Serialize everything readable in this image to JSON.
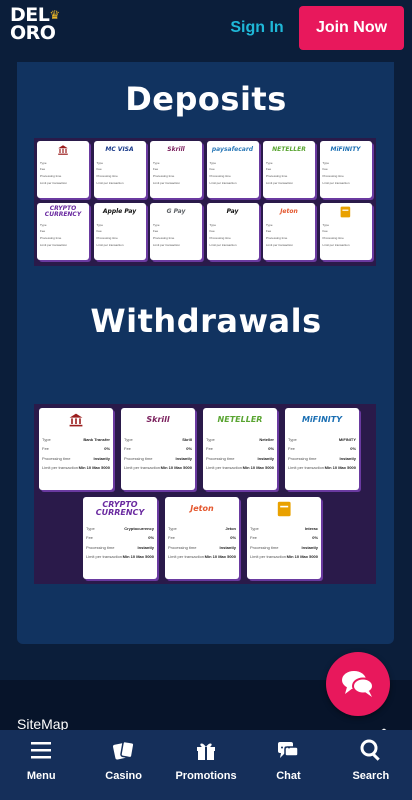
{
  "header": {
    "logo_line1": "DEL",
    "logo_line2": "ORO",
    "sign_in": "Sign In",
    "join_now": "Join Now"
  },
  "sections": {
    "deposits_title": "Deposits",
    "withdrawals_title": "Withdrawals"
  },
  "deposit_methods": [
    {
      "logo": "bank-icon",
      "color": "#9b1d1d"
    },
    {
      "logo": "MC VISA",
      "color": "#1a3a8a"
    },
    {
      "logo": "Skrill",
      "color": "#7a1f5c"
    },
    {
      "logo": "paysafecard",
      "color": "#2d7ab8"
    },
    {
      "logo": "NETELLER",
      "color": "#5aa532"
    },
    {
      "logo": "MiFINITY",
      "color": "#1b6fb3"
    },
    {
      "logo": "CRYPTO CURRENCY",
      "color": "#6a2aa0"
    },
    {
      "logo": "Apple Pay",
      "color": "#111111"
    },
    {
      "logo": "G Pay",
      "color": "#5f6368"
    },
    {
      "logo": "Pay",
      "color": "#111111"
    },
    {
      "logo": "Jeton",
      "color": "#e4572e"
    },
    {
      "logo": "wallet-icon",
      "color": "#e9a100"
    }
  ],
  "withdrawal_methods": [
    {
      "logo": "bank-icon",
      "color": "#9b1d1d",
      "type": "Bank Transfer",
      "fee": "0%",
      "time": "Instantly",
      "limit_min": "Min 10",
      "limit_max": "Max 5000"
    },
    {
      "logo": "Skrill",
      "color": "#7a1f5c",
      "type": "Skrill",
      "fee": "0%",
      "time": "Instantly",
      "limit_min": "Min 10",
      "limit_max": "Max 5000"
    },
    {
      "logo": "NETELLER",
      "color": "#5aa532",
      "type": "Neteller",
      "fee": "0%",
      "time": "Instantly",
      "limit_min": "Min 10",
      "limit_max": "Max 5000"
    },
    {
      "logo": "MiFINITY",
      "color": "#1b6fb3",
      "type": "MiFINITY",
      "fee": "0%",
      "time": "Instantly",
      "limit_min": "Min 10",
      "limit_max": "Max 5000"
    },
    {
      "logo": "CRYPTO CURRENCY",
      "color": "#6a2aa0",
      "type": "Cryptocurrency",
      "fee": "0%",
      "time": "Instantly",
      "limit_min": "Min 10",
      "limit_max": "Max 5000"
    },
    {
      "logo": "Jeton",
      "color": "#e4572e",
      "type": "Jeton",
      "fee": "0%",
      "time": "Instantly",
      "limit_min": "Min 10",
      "limit_max": "Max 5000"
    },
    {
      "logo": "wallet-icon",
      "color": "#e9a100",
      "type": "Interac",
      "fee": "0%",
      "time": "Instantly",
      "limit_min": "Min 10",
      "limit_max": "Max 5000"
    }
  ],
  "row_labels": {
    "type": "Type",
    "fee": "Fee",
    "time": "Processing time",
    "limit": "Limit per transaction"
  },
  "footer": {
    "sitemap": "SiteMap"
  },
  "bottom_nav": [
    {
      "label": "Menu",
      "icon": "menu-icon"
    },
    {
      "label": "Casino",
      "icon": "cards-icon"
    },
    {
      "label": "Promotions",
      "icon": "gift-icon"
    },
    {
      "label": "Chat",
      "icon": "chat-icon"
    },
    {
      "label": "Search",
      "icon": "search-icon"
    }
  ],
  "colors": {
    "background": "#0b1e3a",
    "panel": "#113360",
    "accent_pink": "#e8185c",
    "accent_cyan": "#1fb8d8",
    "card_shadow": "#6a3aa0"
  }
}
